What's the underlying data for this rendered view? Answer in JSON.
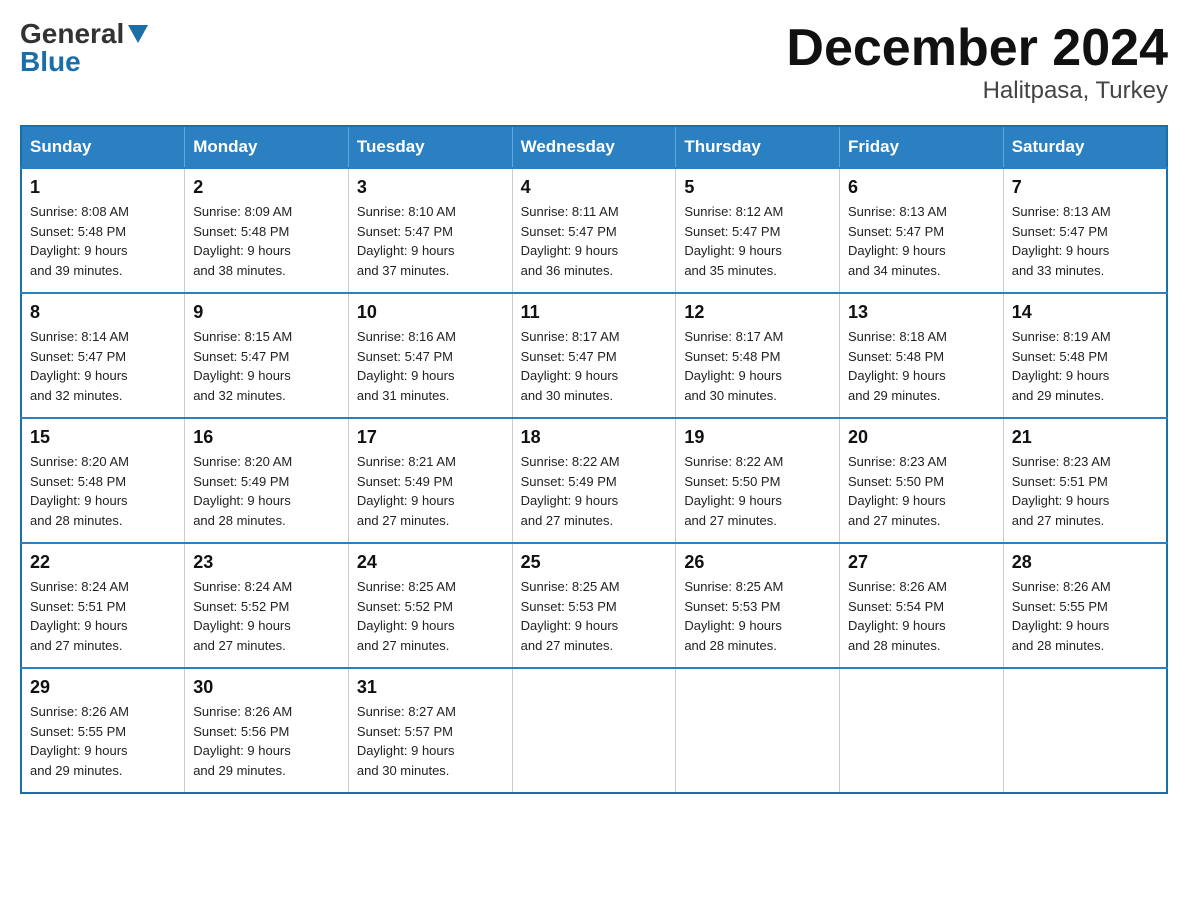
{
  "logo": {
    "general": "General",
    "blue": "Blue"
  },
  "title": "December 2024",
  "subtitle": "Halitpasa, Turkey",
  "weekdays": [
    "Sunday",
    "Monday",
    "Tuesday",
    "Wednesday",
    "Thursday",
    "Friday",
    "Saturday"
  ],
  "weeks": [
    [
      {
        "day": "1",
        "sunrise": "8:08 AM",
        "sunset": "5:48 PM",
        "daylight": "9 hours and 39 minutes."
      },
      {
        "day": "2",
        "sunrise": "8:09 AM",
        "sunset": "5:48 PM",
        "daylight": "9 hours and 38 minutes."
      },
      {
        "day": "3",
        "sunrise": "8:10 AM",
        "sunset": "5:47 PM",
        "daylight": "9 hours and 37 minutes."
      },
      {
        "day": "4",
        "sunrise": "8:11 AM",
        "sunset": "5:47 PM",
        "daylight": "9 hours and 36 minutes."
      },
      {
        "day": "5",
        "sunrise": "8:12 AM",
        "sunset": "5:47 PM",
        "daylight": "9 hours and 35 minutes."
      },
      {
        "day": "6",
        "sunrise": "8:13 AM",
        "sunset": "5:47 PM",
        "daylight": "9 hours and 34 minutes."
      },
      {
        "day": "7",
        "sunrise": "8:13 AM",
        "sunset": "5:47 PM",
        "daylight": "9 hours and 33 minutes."
      }
    ],
    [
      {
        "day": "8",
        "sunrise": "8:14 AM",
        "sunset": "5:47 PM",
        "daylight": "9 hours and 32 minutes."
      },
      {
        "day": "9",
        "sunrise": "8:15 AM",
        "sunset": "5:47 PM",
        "daylight": "9 hours and 32 minutes."
      },
      {
        "day": "10",
        "sunrise": "8:16 AM",
        "sunset": "5:47 PM",
        "daylight": "9 hours and 31 minutes."
      },
      {
        "day": "11",
        "sunrise": "8:17 AM",
        "sunset": "5:47 PM",
        "daylight": "9 hours and 30 minutes."
      },
      {
        "day": "12",
        "sunrise": "8:17 AM",
        "sunset": "5:48 PM",
        "daylight": "9 hours and 30 minutes."
      },
      {
        "day": "13",
        "sunrise": "8:18 AM",
        "sunset": "5:48 PM",
        "daylight": "9 hours and 29 minutes."
      },
      {
        "day": "14",
        "sunrise": "8:19 AM",
        "sunset": "5:48 PM",
        "daylight": "9 hours and 29 minutes."
      }
    ],
    [
      {
        "day": "15",
        "sunrise": "8:20 AM",
        "sunset": "5:48 PM",
        "daylight": "9 hours and 28 minutes."
      },
      {
        "day": "16",
        "sunrise": "8:20 AM",
        "sunset": "5:49 PM",
        "daylight": "9 hours and 28 minutes."
      },
      {
        "day": "17",
        "sunrise": "8:21 AM",
        "sunset": "5:49 PM",
        "daylight": "9 hours and 27 minutes."
      },
      {
        "day": "18",
        "sunrise": "8:22 AM",
        "sunset": "5:49 PM",
        "daylight": "9 hours and 27 minutes."
      },
      {
        "day": "19",
        "sunrise": "8:22 AM",
        "sunset": "5:50 PM",
        "daylight": "9 hours and 27 minutes."
      },
      {
        "day": "20",
        "sunrise": "8:23 AM",
        "sunset": "5:50 PM",
        "daylight": "9 hours and 27 minutes."
      },
      {
        "day": "21",
        "sunrise": "8:23 AM",
        "sunset": "5:51 PM",
        "daylight": "9 hours and 27 minutes."
      }
    ],
    [
      {
        "day": "22",
        "sunrise": "8:24 AM",
        "sunset": "5:51 PM",
        "daylight": "9 hours and 27 minutes."
      },
      {
        "day": "23",
        "sunrise": "8:24 AM",
        "sunset": "5:52 PM",
        "daylight": "9 hours and 27 minutes."
      },
      {
        "day": "24",
        "sunrise": "8:25 AM",
        "sunset": "5:52 PM",
        "daylight": "9 hours and 27 minutes."
      },
      {
        "day": "25",
        "sunrise": "8:25 AM",
        "sunset": "5:53 PM",
        "daylight": "9 hours and 27 minutes."
      },
      {
        "day": "26",
        "sunrise": "8:25 AM",
        "sunset": "5:53 PM",
        "daylight": "9 hours and 28 minutes."
      },
      {
        "day": "27",
        "sunrise": "8:26 AM",
        "sunset": "5:54 PM",
        "daylight": "9 hours and 28 minutes."
      },
      {
        "day": "28",
        "sunrise": "8:26 AM",
        "sunset": "5:55 PM",
        "daylight": "9 hours and 28 minutes."
      }
    ],
    [
      {
        "day": "29",
        "sunrise": "8:26 AM",
        "sunset": "5:55 PM",
        "daylight": "9 hours and 29 minutes."
      },
      {
        "day": "30",
        "sunrise": "8:26 AM",
        "sunset": "5:56 PM",
        "daylight": "9 hours and 29 minutes."
      },
      {
        "day": "31",
        "sunrise": "8:27 AM",
        "sunset": "5:57 PM",
        "daylight": "9 hours and 30 minutes."
      },
      null,
      null,
      null,
      null
    ]
  ]
}
